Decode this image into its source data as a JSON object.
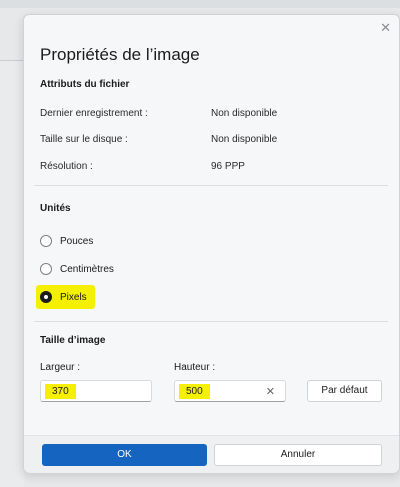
{
  "dialog": {
    "title": "Propriétés de l’image",
    "close_icon": "close-icon"
  },
  "file_attributes": {
    "heading": "Attributs du fichier",
    "rows": [
      {
        "label": "Dernier enregistrement :",
        "value": "Non disponible"
      },
      {
        "label": "Taille sur le disque :",
        "value": "Non disponible"
      },
      {
        "label": "Résolution :",
        "value": "96 PPP"
      }
    ]
  },
  "units": {
    "heading": "Unités",
    "options": [
      {
        "label": "Pouces",
        "selected": false
      },
      {
        "label": "Centimètres",
        "selected": false
      },
      {
        "label": "Pixels",
        "selected": true
      }
    ]
  },
  "image_size": {
    "heading": "Taille d’image",
    "width_label": "Largeur :",
    "width_value": "370",
    "height_label": "Hauteur :",
    "height_value": "500",
    "default_button": "Par défaut"
  },
  "buttons": {
    "ok": "OK",
    "cancel": "Annuler"
  },
  "colors": {
    "accent": "#1565c0",
    "highlight": "#f5ef00"
  }
}
